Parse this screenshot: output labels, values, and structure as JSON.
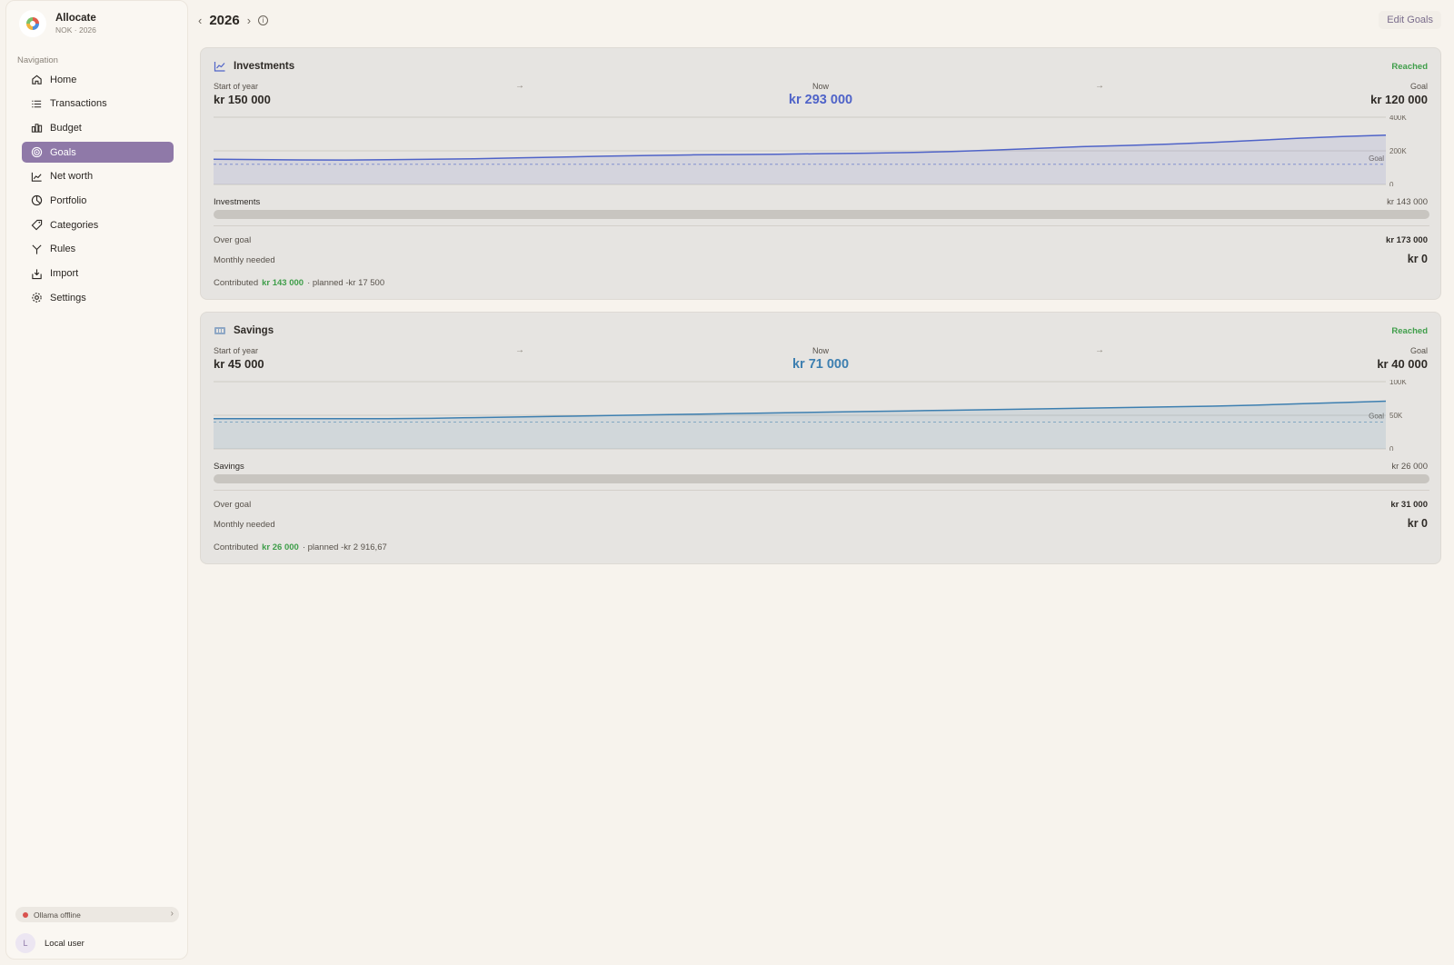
{
  "app": {
    "name": "Allocate",
    "subtitle": "NOK · 2026"
  },
  "sidebar": {
    "heading": "Navigation",
    "items": [
      {
        "label": "Home",
        "icon": "home-icon"
      },
      {
        "label": "Transactions",
        "icon": "list-icon"
      },
      {
        "label": "Budget",
        "icon": "bar-chart-icon"
      },
      {
        "label": "Goals",
        "icon": "target-icon",
        "active": true
      },
      {
        "label": "Net worth",
        "icon": "trend-icon"
      },
      {
        "label": "Portfolio",
        "icon": "pie-icon"
      },
      {
        "label": "Categories",
        "icon": "tag-icon"
      },
      {
        "label": "Rules",
        "icon": "split-icon"
      },
      {
        "label": "Import",
        "icon": "import-icon"
      },
      {
        "label": "Settings",
        "icon": "gear-icon"
      }
    ],
    "status": "Ollama offline",
    "user_initial": "L",
    "user_name": "Local user"
  },
  "header": {
    "year": "2026",
    "edit_label": "Edit Goals"
  },
  "goals": [
    {
      "name": "Investments",
      "status": "Reached",
      "start_label": "Start of year",
      "start_value": "kr 150 000",
      "now_label": "Now",
      "now_value": "kr 293 000",
      "goal_label": "Goal",
      "goal_value": "kr 120 000",
      "accent": "#4f63c8",
      "bar_label": "Investments",
      "bar_value": "kr 143 000",
      "bar_fill": 1.0,
      "over_label": "Over goal",
      "over_value": "kr 173 000",
      "monthly_label": "Monthly needed",
      "monthly_value": "kr 0",
      "contrib_label": "Contributed",
      "contrib_value": "kr 143 000",
      "planned": "· planned -kr 17 500",
      "chart": {
        "ticks": [
          "400K",
          "200K",
          "0"
        ],
        "ymax": 400000,
        "goal": 120000,
        "goal_label": "Goal",
        "values": [
          150000,
          148000,
          146000,
          145000,
          147000,
          150000,
          153000,
          158000,
          163000,
          168000,
          172000,
          176000,
          178000,
          180000,
          183000,
          186000,
          190000,
          196000,
          205000,
          215000,
          225000,
          232000,
          240000,
          250000,
          262000,
          275000,
          285000,
          293000
        ]
      }
    },
    {
      "name": "Savings",
      "status": "Reached",
      "start_label": "Start of year",
      "start_value": "kr 45 000",
      "now_label": "Now",
      "now_value": "kr 71 000",
      "goal_label": "Goal",
      "goal_value": "kr 40 000",
      "accent": "#3d7fb0",
      "bar_label": "Savings",
      "bar_value": "kr 26 000",
      "bar_fill": 1.0,
      "over_label": "Over goal",
      "over_value": "kr 31 000",
      "monthly_label": "Monthly needed",
      "monthly_value": "kr 0",
      "contrib_label": "Contributed",
      "contrib_value": "kr 26 000",
      "planned": "· planned -kr 2 916,67",
      "chart": {
        "ticks": [
          "100K",
          "50K",
          "0"
        ],
        "ymax": 100000,
        "goal": 40000,
        "goal_label": "Goal",
        "values": [
          45000,
          45000,
          45000,
          45000,
          45000,
          45500,
          46500,
          47500,
          48500,
          49500,
          50500,
          51500,
          52500,
          53500,
          54500,
          55500,
          56500,
          57500,
          58500,
          59500,
          60500,
          61500,
          62500,
          63500,
          65000,
          67000,
          69000,
          71000
        ]
      }
    }
  ]
}
